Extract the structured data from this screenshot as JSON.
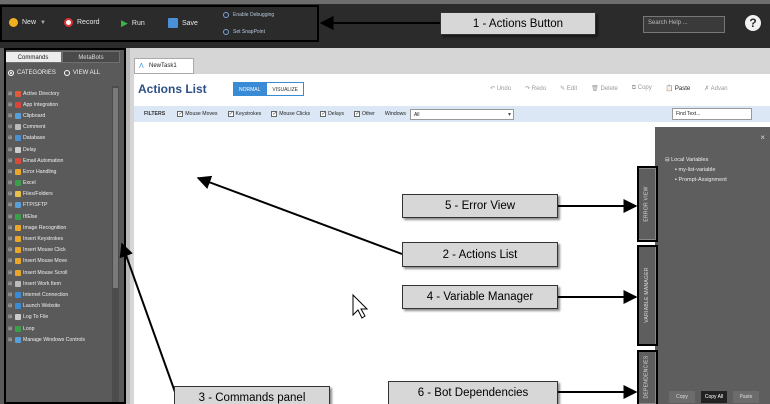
{
  "toolbar": {
    "new_label": "New",
    "record_label": "Record",
    "run_label": "Run",
    "save_label": "Save",
    "enable_debugging": "Enable Debugging",
    "set_snappoint": "Set SnapPoint",
    "search_placeholder": "Search Help ...",
    "help": "?"
  },
  "left_panel": {
    "tabs": [
      "Commands",
      "MetaBots"
    ],
    "filters": [
      "CATEGORIES",
      "VIEW ALL"
    ],
    "commands": [
      {
        "label": "Active Directory",
        "color": "#e05b3a"
      },
      {
        "label": "App Integration",
        "color": "#d9453a"
      },
      {
        "label": "Clipboard",
        "color": "#5a9fd6"
      },
      {
        "label": "Comment",
        "color": "#bbbbbb"
      },
      {
        "label": "Database",
        "color": "#4a8fcf"
      },
      {
        "label": "Delay",
        "color": "#cccccc"
      },
      {
        "label": "Email Automation",
        "color": "#d94a3a"
      },
      {
        "label": "Error Handling",
        "color": "#e8a72a"
      },
      {
        "label": "Excel",
        "color": "#3b9e4a"
      },
      {
        "label": "Files/Folders",
        "color": "#e8c14a"
      },
      {
        "label": "FTP/SFTP",
        "color": "#5a9fd6"
      },
      {
        "label": "If/Else",
        "color": "#3b9e4a"
      },
      {
        "label": "Image Recognition",
        "color": "#e8a72a"
      },
      {
        "label": "Insert Keystrokes",
        "color": "#e8a72a"
      },
      {
        "label": "Insert Mouse Click",
        "color": "#e8a72a"
      },
      {
        "label": "Insert Mouse Move",
        "color": "#e8a72a"
      },
      {
        "label": "Insert Mouse Scroll",
        "color": "#e8a72a"
      },
      {
        "label": "Insert Work Item",
        "color": "#bbbbbb"
      },
      {
        "label": "Internet Connection",
        "color": "#3a8bd6"
      },
      {
        "label": "Launch Website",
        "color": "#3a8bd6"
      },
      {
        "label": "Log To File",
        "color": "#cccccc"
      },
      {
        "label": "Loop",
        "color": "#3b9e4a"
      },
      {
        "label": "Manage Windows Controls",
        "color": "#5a9fd6"
      }
    ]
  },
  "main": {
    "doc_tab": "NewTask1",
    "title": "Actions List",
    "view_modes": [
      "NORMAL",
      "VISUALIZE"
    ],
    "actions": [
      "Undo",
      "Redo",
      "Edit",
      "Delete",
      "Copy",
      "Paste",
      "Advan"
    ],
    "filters": {
      "label": "FILTERS",
      "checks": [
        "Mouse Moves",
        "Keystrokes",
        "Mouse Clicks",
        "Delays",
        "Other"
      ],
      "windows_label": "Windows",
      "windows_value": "All",
      "find_placeholder": "Find Text..."
    }
  },
  "right_panel": {
    "close": "×",
    "tree": [
      "Local Variables",
      "my-list-variable",
      "Prompt-Assignment"
    ],
    "vertical_tabs": [
      "ERROR VIEW",
      "VARIABLE MANAGER",
      "DEPENDENCIES"
    ],
    "bottom_buttons": [
      "Copy",
      "Copy All",
      "Paste"
    ]
  },
  "callouts": [
    "1 - Actions Button",
    "2 - Actions List",
    "3 - Commands panel",
    "4 - Variable Manager",
    "5 - Error View",
    "6 - Bot Dependencies"
  ],
  "colors": {
    "toolbar_bg": "#2b2b2b",
    "panel_bg": "#5a5a5a",
    "accent_blue": "#3a8bd6",
    "title_blue": "#2d4f86",
    "filter_bar": "#dbe7f4"
  }
}
